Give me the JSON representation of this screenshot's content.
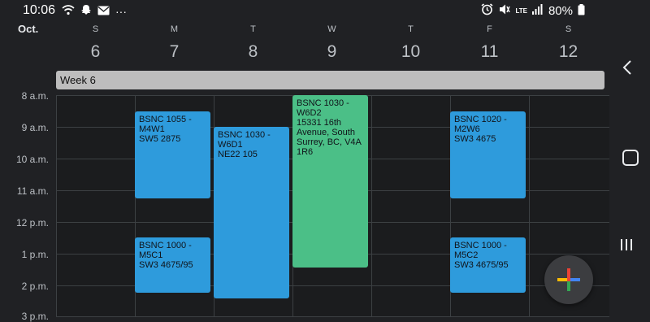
{
  "status_bar": {
    "time": "10:06",
    "more": "···",
    "network": "LTE",
    "battery": "80%"
  },
  "header": {
    "month": "Oct.",
    "days": [
      {
        "dow": "S",
        "num": "6"
      },
      {
        "dow": "M",
        "num": "7"
      },
      {
        "dow": "T",
        "num": "8"
      },
      {
        "dow": "W",
        "num": "9"
      },
      {
        "dow": "T",
        "num": "10"
      },
      {
        "dow": "F",
        "num": "11"
      },
      {
        "dow": "S",
        "num": "12"
      }
    ]
  },
  "week_banner": "Week 6",
  "time_labels": [
    "8 a.m.",
    "9 a.m.",
    "10 a.m.",
    "11 a.m.",
    "12 p.m.",
    "1 p.m.",
    "2 p.m.",
    "3 p.m."
  ],
  "events": [
    {
      "title": "BSNC 1055 - M4W1",
      "location": "SW5 2875",
      "color": "#2e9bdc"
    },
    {
      "title": "BSNC 1030 - W6D1",
      "location": "NE22 105",
      "color": "#2e9bdc"
    },
    {
      "title": "BSNC 1030 - W6D2",
      "location": " 15331 16th Avenue, South Surrey, BC, V4A 1R6",
      "color": "#4bbf87"
    },
    {
      "title": "BSNC 1020 - M2W6",
      "location": "SW3 4675",
      "color": "#2e9bdc"
    },
    {
      "title": "BSNC 1000 - M5C1",
      "location": "SW3 4675/95",
      "color": "#2e9bdc"
    },
    {
      "title": "BSNC 1000 - M5C2",
      "location": "SW3 4675/95",
      "color": "#2e9bdc"
    }
  ],
  "icons": {
    "wifi": "wifi-icon",
    "snapchat": "snapchat-icon",
    "mail": "mail-icon",
    "alarm": "alarm-icon",
    "mute": "mute-icon",
    "signal": "signal-icon",
    "battery": "battery-icon",
    "back": "back-icon",
    "home": "home-icon",
    "recent": "recent-apps-icon",
    "add": "add-icon"
  }
}
